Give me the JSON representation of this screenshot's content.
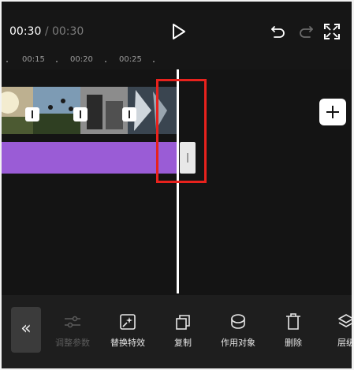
{
  "player": {
    "current_time": "00:30",
    "separator": "/",
    "total_time": "00:30"
  },
  "ruler": {
    "ticks": [
      "00:15",
      "00:20",
      "00:25"
    ]
  },
  "toolbar": {
    "items": [
      {
        "label": "调整参数",
        "icon": "adjust-sliders-icon",
        "enabled": false
      },
      {
        "label": "替换特效",
        "icon": "replace-effect-icon",
        "enabled": true
      },
      {
        "label": "复制",
        "icon": "copy-icon",
        "enabled": true
      },
      {
        "label": "作用对象",
        "icon": "apply-target-icon",
        "enabled": true
      },
      {
        "label": "删除",
        "icon": "delete-icon",
        "enabled": true
      },
      {
        "label": "层级",
        "icon": "layers-icon",
        "enabled": true
      }
    ]
  },
  "colors": {
    "effect_track": "#9a5cd6",
    "highlight": "#e8221d",
    "background": "#141414"
  }
}
